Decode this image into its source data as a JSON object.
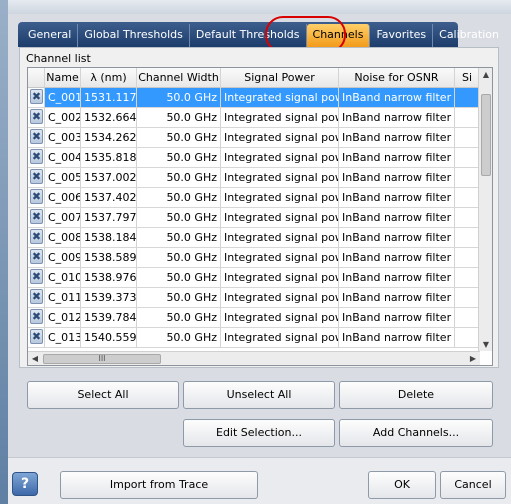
{
  "tabs": [
    {
      "label": "General"
    },
    {
      "label": "Global Thresholds"
    },
    {
      "label": "Default Thresholds"
    },
    {
      "label": "Channels"
    },
    {
      "label": "Favorites"
    },
    {
      "label": "Calibration"
    }
  ],
  "active_tab": "Channels",
  "channel_list": {
    "group_label": "Channel list",
    "columns": [
      "Name",
      "λ (nm)",
      "Channel Width",
      "Signal Power",
      "Noise for OSNR",
      "Si"
    ],
    "rows": [
      {
        "name": "C_001",
        "lambda": "1531.117",
        "width": "50.0 GHz",
        "power": "Integrated signal power",
        "noise": "InBand narrow filter",
        "si": "",
        "selected": true
      },
      {
        "name": "C_002",
        "lambda": "1532.664",
        "width": "50.0 GHz",
        "power": "Integrated signal power",
        "noise": "InBand narrow filter",
        "si": ""
      },
      {
        "name": "C_003",
        "lambda": "1534.262",
        "width": "50.0 GHz",
        "power": "Integrated signal power",
        "noise": "InBand narrow filter",
        "si": ""
      },
      {
        "name": "C_004",
        "lambda": "1535.818",
        "width": "50.0 GHz",
        "power": "Integrated signal power",
        "noise": "InBand narrow filter",
        "si": ""
      },
      {
        "name": "C_005",
        "lambda": "1537.002",
        "width": "50.0 GHz",
        "power": "Integrated signal power",
        "noise": "InBand narrow filter",
        "si": ""
      },
      {
        "name": "C_006",
        "lambda": "1537.402",
        "width": "50.0 GHz",
        "power": "Integrated signal power",
        "noise": "InBand narrow filter",
        "si": ""
      },
      {
        "name": "C_007",
        "lambda": "1537.797",
        "width": "50.0 GHz",
        "power": "Integrated signal power",
        "noise": "InBand narrow filter",
        "si": ""
      },
      {
        "name": "C_008",
        "lambda": "1538.184",
        "width": "50.0 GHz",
        "power": "Integrated signal power",
        "noise": "InBand narrow filter",
        "si": ""
      },
      {
        "name": "C_009",
        "lambda": "1538.589",
        "width": "50.0 GHz",
        "power": "Integrated signal power",
        "noise": "InBand narrow filter",
        "si": ""
      },
      {
        "name": "C_010",
        "lambda": "1538.976",
        "width": "50.0 GHz",
        "power": "Integrated signal power",
        "noise": "InBand narrow filter",
        "si": ""
      },
      {
        "name": "C_011",
        "lambda": "1539.373",
        "width": "50.0 GHz",
        "power": "Integrated signal power",
        "noise": "InBand narrow filter",
        "si": ""
      },
      {
        "name": "C_012",
        "lambda": "1539.784",
        "width": "50.0 GHz",
        "power": "Integrated signal power",
        "noise": "InBand narrow filter",
        "si": ""
      },
      {
        "name": "C_013",
        "lambda": "1540.559",
        "width": "50.0 GHz",
        "power": "Integrated signal power",
        "noise": "InBand narrow filter",
        "si": ""
      }
    ],
    "remove_glyph": "✖",
    "hscroll_grip": "III"
  },
  "buttons": {
    "select_all": "Select All",
    "unselect_all": "Unselect All",
    "delete": "Delete",
    "edit_selection": "Edit Selection...",
    "add_channels": "Add Channels...",
    "import_from_trace": "Import from Trace",
    "ok": "OK",
    "cancel": "Cancel",
    "help": "?"
  },
  "colors": {
    "tab_bar": "#1c3d6b",
    "active_tab": "#f29b19",
    "selection": "#3399ff",
    "highlight_circle": "#d90000"
  }
}
